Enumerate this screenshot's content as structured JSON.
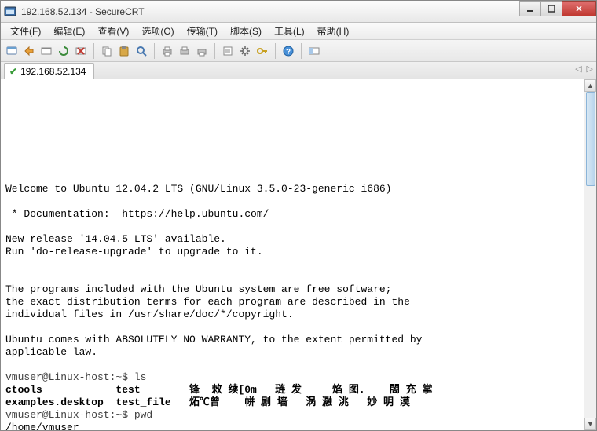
{
  "window": {
    "title": "192.168.52.134 - SecureCRT"
  },
  "menu": {
    "file": "文件(F)",
    "edit": "编辑(E)",
    "view": "查看(V)",
    "options": "选项(O)",
    "transfer": "传输(T)",
    "script": "脚本(S)",
    "tools": "工具(L)",
    "help": "帮助(H)"
  },
  "tab": {
    "label": "192.168.52.134"
  },
  "terminal": {
    "blank1": "",
    "blank2": "",
    "blank3": "",
    "blank4": "",
    "blank5": "",
    "blank6": "",
    "blank7": "",
    "blank8": "",
    "welcome": "Welcome to Ubuntu 12.04.2 LTS (GNU/Linux 3.5.0-23-generic i686)",
    "blank9": "",
    "docline": " * Documentation:  https://help.ubuntu.com/",
    "blank10": "",
    "rel1": "New release '14.04.5 LTS' available.",
    "rel2": "Run 'do-release-upgrade' to upgrade to it.",
    "blank11": "",
    "blank12": "",
    "free1": "The programs included with the Ubuntu system are free software;",
    "free2": "the exact distribution terms for each program are described in the",
    "free3": "individual files in /usr/share/doc/*/copyright.",
    "blank13": "",
    "warr1": "Ubuntu comes with ABSOLUTELY NO WARRANTY, to the extent permitted by",
    "warr2": "applicable law.",
    "blank14": "",
    "p1": "vmuser@Linux-host:~$ ls",
    "ls1": "ctools            test        锋  敕 续[0m   琏 发     焰 图.    閤 充 掌",
    "ls2": "examples.desktop  test_file   炻℃曾    帡 剧 墙   涡 瀜 洮   妙 明 漠",
    "p2": "vmuser@Linux-host:~$ pwd",
    "pwd1": "/home/vmuser"
  }
}
